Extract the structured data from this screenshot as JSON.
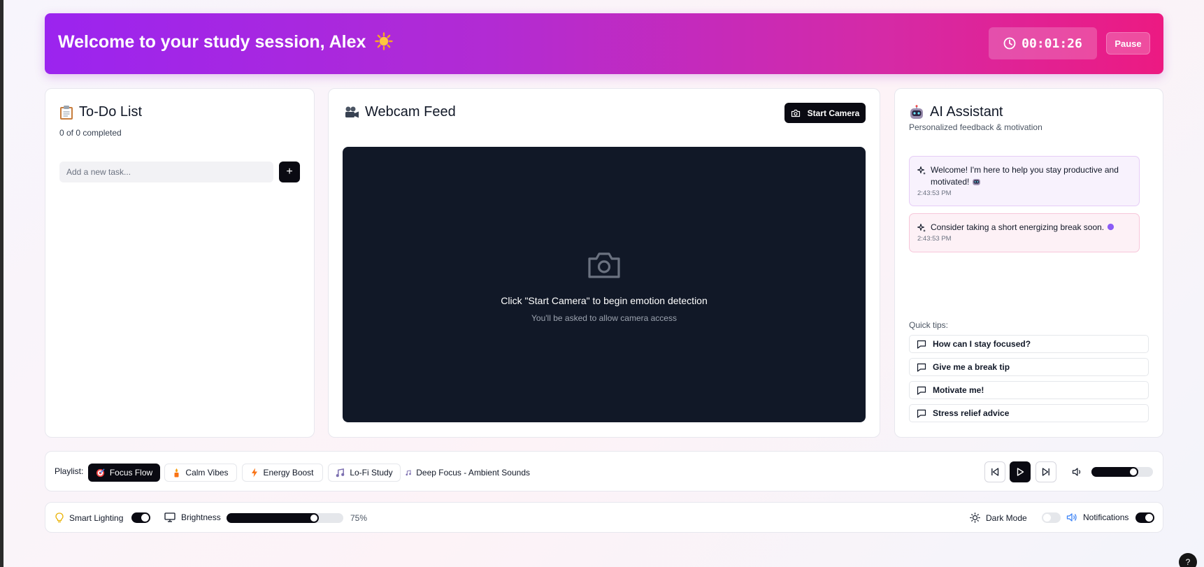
{
  "header": {
    "title": "Welcome to your study session, Alex",
    "title_icon": "sun-emoji",
    "timer": "00:01:26",
    "pause_label": "Pause"
  },
  "todo": {
    "icon": "clipboard-emoji",
    "title": "To-Do List",
    "progress": "0 of 0 completed",
    "input_value": "",
    "input_placeholder": "Add a new task...",
    "add_label": "+"
  },
  "webcam": {
    "icon": "movie-camera-emoji",
    "title": "Webcam Feed",
    "start_label": "Start Camera",
    "prompt": "Click \"Start Camera\" to begin emotion detection",
    "note": "You'll be asked to allow camera access"
  },
  "assistant": {
    "icon": "robot-emoji",
    "title": "AI Assistant",
    "subtitle": "Personalized feedback & motivation",
    "messages": [
      {
        "text": "Welcome! I'm here to help you stay productive and motivated!",
        "emoji": "robot-emoji",
        "time": "2:43:53 PM"
      },
      {
        "text": "Consider taking a short energizing break soon.",
        "emoji": "purple-circle-emoji",
        "time": "2:43:53 PM"
      }
    ],
    "tips_label": "Quick tips:",
    "tips": [
      "How can I stay focused?",
      "Give me a break tip",
      "Motivate me!",
      "Stress relief advice"
    ]
  },
  "playlist": {
    "label": "Playlist:",
    "items": [
      {
        "label": "Focus Flow",
        "icon": "target-emoji",
        "active": true
      },
      {
        "label": "Calm Vibes",
        "icon": "candle-emoji",
        "active": false
      },
      {
        "label": "Energy Boost",
        "icon": "bolt-emoji",
        "active": false
      },
      {
        "label": "Lo-Fi Study",
        "icon": "music-note-icon",
        "active": false
      }
    ],
    "now_playing": "Deep Focus - Ambient Sounds",
    "volume": 0.68
  },
  "settings": {
    "smart_lighting": {
      "label": "Smart Lighting",
      "on": true
    },
    "brightness": {
      "label": "Brightness",
      "value": 75,
      "display": "75%"
    },
    "dark_mode": {
      "label": "Dark Mode",
      "on": false
    },
    "notifications": {
      "label": "Notifications",
      "on": true
    }
  },
  "help_label": "?",
  "colors": {
    "header_gradient": [
      "#9b24ef",
      "#ec1a82"
    ],
    "dark": "#0a0a12",
    "camera_bg": "#111827"
  }
}
